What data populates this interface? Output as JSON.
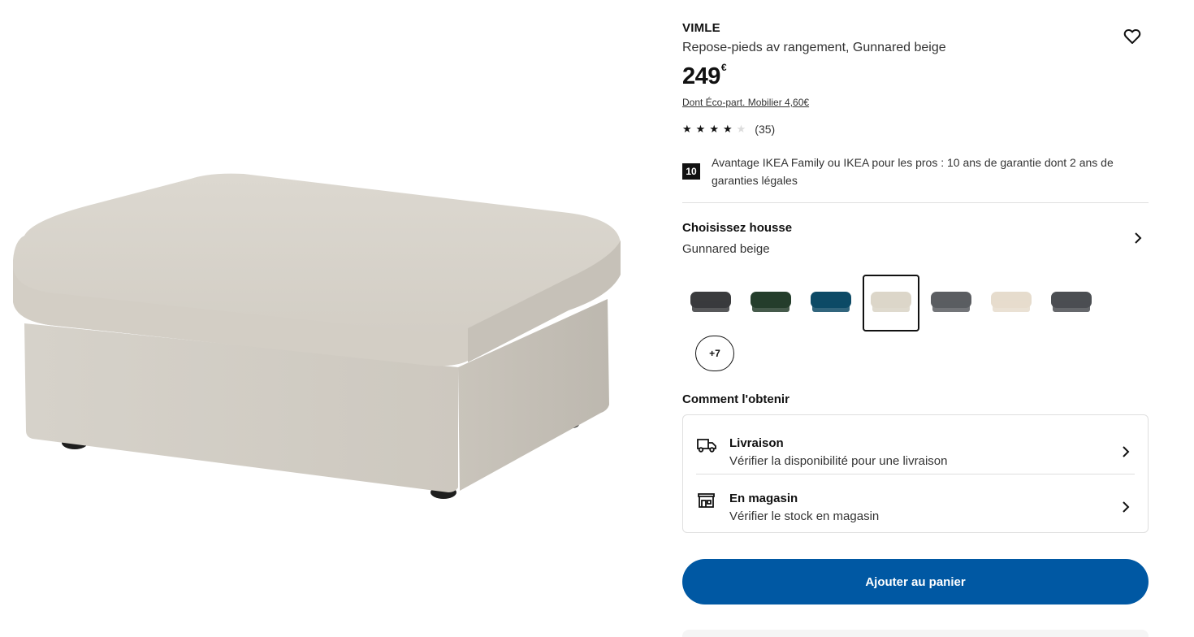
{
  "product": {
    "brand": "VIMLE",
    "subtitle": "Repose-pieds av rangement, Gunnared beige",
    "price_main": "249",
    "price_currency": "€",
    "eco_part": "Dont Éco-part. Mobilier 4,60€",
    "rating": {
      "stars": 4,
      "max": 5,
      "count": "(35)"
    },
    "family_badge": "10",
    "family_text": "Avantage IKEA Family ou IKEA pour les pros : 10 ans de garantie dont 2 ans de garanties légales",
    "image_icon": "ottoman-product-image"
  },
  "cover": {
    "title": "Choisissez housse",
    "value": "Gunnared beige",
    "swatches": [
      {
        "color": "#3a3b3d",
        "selected": false
      },
      {
        "color": "#243d2b",
        "selected": false
      },
      {
        "color": "#0d4a66",
        "selected": false
      },
      {
        "color": "#dcd6c9",
        "selected": true
      },
      {
        "color": "#5b5d61",
        "selected": false
      },
      {
        "color": "#e6dccd",
        "selected": false
      },
      {
        "color": "#4b4e52",
        "selected": false
      }
    ],
    "more_label": "+7"
  },
  "delivery": {
    "heading": "Comment l'obtenir",
    "options": [
      {
        "title": "Livraison",
        "subtitle": "Vérifier la disponibilité pour une livraison",
        "icon": "truck-icon"
      },
      {
        "title": "En magasin",
        "subtitle": "Vérifier le stock en magasin",
        "icon": "store-icon"
      }
    ]
  },
  "cta": {
    "label": "Ajouter au panier",
    "color": "#0058a3"
  },
  "icons": {
    "favorite": "heart-icon",
    "chevron": "chevron-right-icon"
  }
}
